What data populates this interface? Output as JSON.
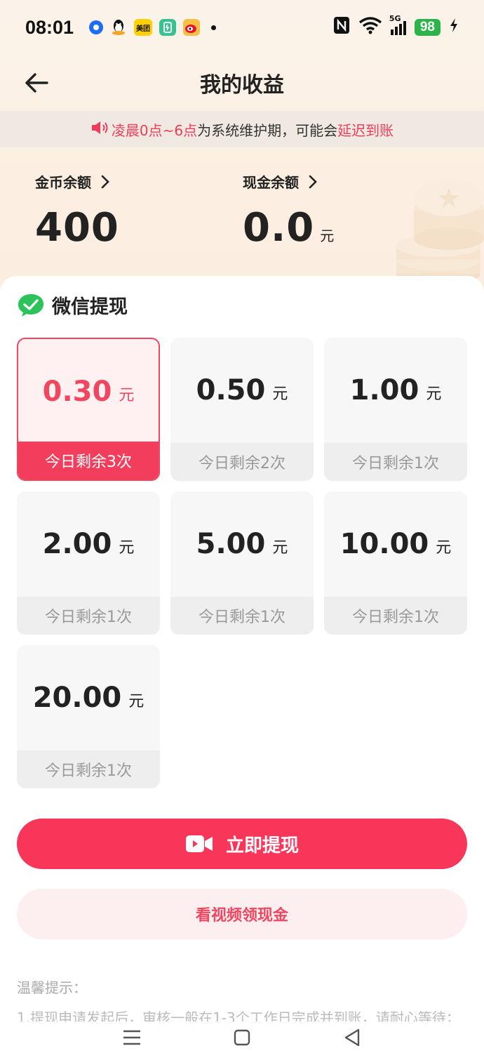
{
  "status_bar": {
    "time": "08:01",
    "app_icons": [
      "blue-circle-icon",
      "qq-icon",
      "meituan-icon",
      "green-app-icon",
      "weibo-icon"
    ],
    "meituan_label": "美团",
    "network_label": "5G",
    "battery": "98"
  },
  "header": {
    "title": "我的收益"
  },
  "notice": {
    "part1": "凌晨0点~6点",
    "part2": "为系统维护期，可能会",
    "part3": "延迟到账"
  },
  "balances": {
    "coin_label": "金币余额",
    "coin_value": "400",
    "cash_label": "现金余额",
    "cash_value": "0.0",
    "cash_unit": "元"
  },
  "withdraw": {
    "section_title": "微信提现",
    "options": [
      {
        "amount": "0.30",
        "unit": "元",
        "remaining": "今日剩余3次",
        "selected": true
      },
      {
        "amount": "0.50",
        "unit": "元",
        "remaining": "今日剩余2次",
        "selected": false
      },
      {
        "amount": "1.00",
        "unit": "元",
        "remaining": "今日剩余1次",
        "selected": false
      },
      {
        "amount": "2.00",
        "unit": "元",
        "remaining": "今日剩余1次",
        "selected": false
      },
      {
        "amount": "5.00",
        "unit": "元",
        "remaining": "今日剩余1次",
        "selected": false
      },
      {
        "amount": "10.00",
        "unit": "元",
        "remaining": "今日剩余1次",
        "selected": false
      },
      {
        "amount": "20.00",
        "unit": "元",
        "remaining": "今日剩余1次",
        "selected": false
      }
    ],
    "withdraw_button": "立即提现",
    "video_button": "看视频领现金"
  },
  "tips": {
    "title": "温馨提示：",
    "text": "1.提现申请发起后，审核一般在1-3个工作日完成并到账，请耐心等待；"
  },
  "colors": {
    "accent": "#f7365a",
    "accent_light": "#fdeef0",
    "notice_red": "#f03c5a",
    "header_bg": "#fbf3ea"
  }
}
